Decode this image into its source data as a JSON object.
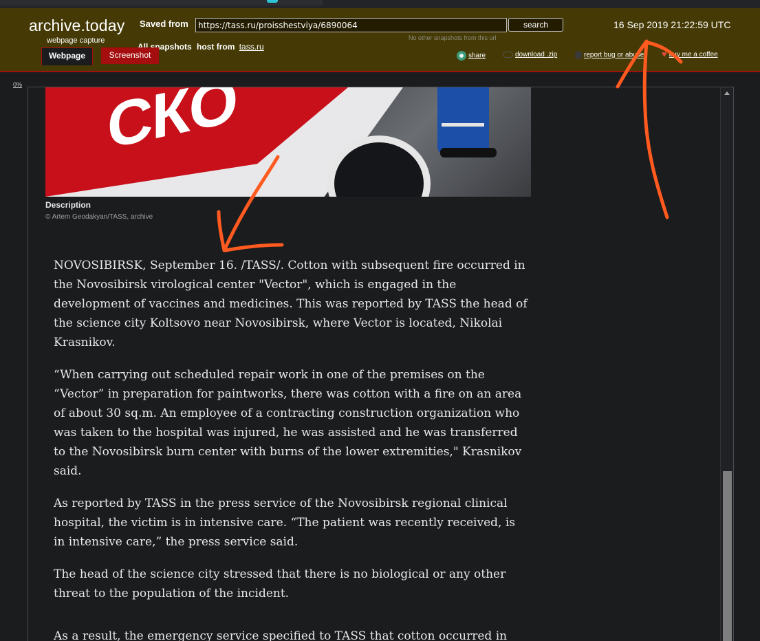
{
  "header": {
    "brand": "archive.today",
    "brand_sub": "webpage capture",
    "saved_label": "Saved from",
    "url_value": "https://tass.ru/proisshestviya/6890064",
    "search_label": "search",
    "no_snapshots": "No other snapshots from this url",
    "all_snapshots": "All snapshots",
    "host_from": "host from",
    "host_link": "tass.ru",
    "datetime": "16 Sep 2019 21:22:59 UTC"
  },
  "tabs": {
    "webpage": "Webpage",
    "screenshot": "Screenshot"
  },
  "actions": {
    "share": "share",
    "download": "download .zip",
    "report": "report bug or abuse",
    "coffee": "buy me a coffee"
  },
  "progress": "0%",
  "article": {
    "photo_letters": "СКО",
    "description": "Description",
    "credit": "© Artem Geodakyan/TASS, archive",
    "paragraphs": [
      "NOVOSIBIRSK, September 16. /TASS/. Cotton with subsequent fire occurred in the Novosibirsk virological center \"Vector\", which is engaged in the development of vaccines and medicines. This was reported by TASS the head of the science city Koltsovo near Novosibirsk, where Vector is located, Nikolai Krasnikov.",
      "“When carrying out scheduled repair work in one of the premises on the “Vector” in preparation for paintworks, there was cotton with a fire on an area of about 30 sq.m. An employee of a contracting construction organization who was taken to the hospital was injured, he was assisted and he was transferred to the Novosibirsk burn center with burns of the lower extremities,\" Krasnikov said.",
      "As reported by TASS in the press service of the Novosibirsk regional clinical hospital, the victim is in intensive care. “The patient was recently received, is in intensive care,” the press service said.",
      "The head of the science city stressed that there is no biological or any other threat to the population of the incident.",
      "As a result, the emergency service specified to TASS that cotton occurred in"
    ]
  },
  "colors": {
    "header_bg": "#453a06",
    "accent_red": "#a50e0e",
    "annotation_orange": "#ff5a1f",
    "page_bg": "#1b1c1e"
  },
  "icons": [
    "share-icon",
    "cloud-download-icon",
    "bug-icon",
    "heart-icon",
    "scroll-up-arrow-icon"
  ]
}
